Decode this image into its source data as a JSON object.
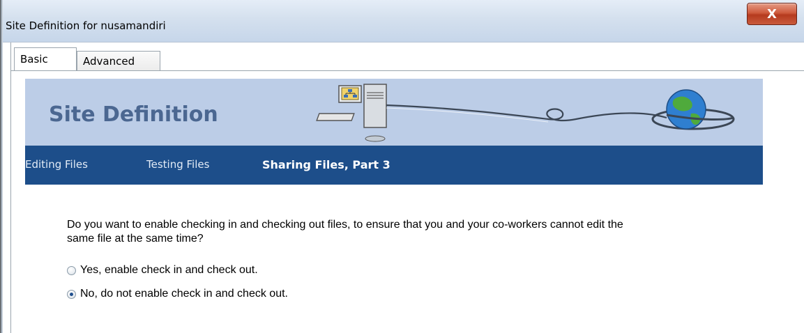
{
  "window": {
    "title": "Site Definition for nusamandiri",
    "close_glyph": "X"
  },
  "tabs": [
    {
      "label": "Basic",
      "selected": true
    },
    {
      "label": "Advanced",
      "selected": false
    }
  ],
  "banner": {
    "title": "Site Definition",
    "illustration": [
      "computer-icon",
      "globe-icon"
    ]
  },
  "nav": {
    "editing": "Editing Files",
    "testing": "Testing Files",
    "sharing": "Sharing Files, Part 3"
  },
  "question": {
    "text": "Do you want to enable checking in and checking out files, to ensure that you and your co-workers cannot edit the same file at the same time?",
    "options": [
      {
        "label": "Yes, enable check in and check out.",
        "selected": false
      },
      {
        "label": "No, do not enable check in and check out.",
        "selected": true
      }
    ]
  },
  "colors": {
    "banner_bg": "#bccde7",
    "nav_bg": "#1d4e8a",
    "title_color": "#4b6791"
  }
}
